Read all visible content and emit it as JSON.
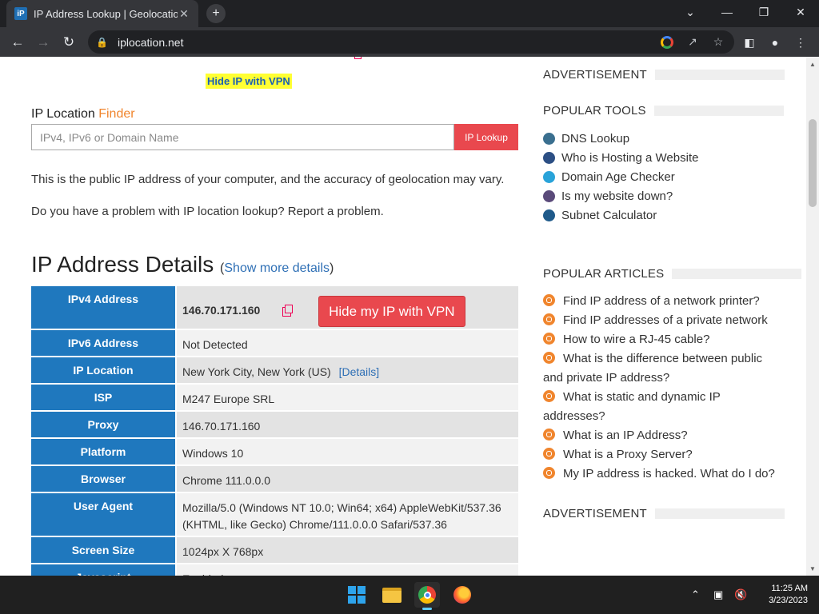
{
  "browser": {
    "tab_title": "IP Address Lookup | Geolocation",
    "tab_favicon": "iP",
    "tab_close": "✕",
    "new_tab": "+",
    "url": "iplocation.net",
    "window_controls": {
      "dropdown": "⌄",
      "minimize": "—",
      "restore": "❐",
      "close": "✕"
    }
  },
  "page": {
    "vpn_link": "Hide IP with VPN",
    "finder": {
      "title_main": "IP Location",
      "title_accent": "Finder",
      "placeholder": "IPv4, IPv6 or Domain Name",
      "button": "IP Lookup"
    },
    "para1": "This is the public IP address of your computer, and the accuracy of geolocation may vary.",
    "para2": "Do you have a problem with IP location lookup? Report a problem.",
    "details_heading": "IP Address Details",
    "details_paren_open": "(",
    "details_link": "Show more details",
    "details_paren_close": ")",
    "hide_vpn_button": "Hide my IP with VPN",
    "rows": [
      {
        "label": "IPv4 Address",
        "value": "146.70.171.160"
      },
      {
        "label": "IPv6 Address",
        "value": "Not Detected"
      },
      {
        "label": "IP Location",
        "value": "New York City, New York (US)",
        "link": "[Details]"
      },
      {
        "label": "ISP",
        "value": "M247 Europe SRL"
      },
      {
        "label": "Proxy",
        "value": "146.70.171.160"
      },
      {
        "label": "Platform",
        "value": "Windows 10"
      },
      {
        "label": "Browser",
        "value": "Chrome 111.0.0.0"
      },
      {
        "label": "User Agent",
        "value": "Mozilla/5.0 (Windows NT 10.0; Win64; x64) AppleWebKit/537.36 (KHTML, like Gecko) Chrome/111.0.0.0 Safari/537.36"
      },
      {
        "label": "Screen Size",
        "value": "1024px X 768px"
      },
      {
        "label": "Javascript",
        "value": "Enabled"
      }
    ]
  },
  "sidebar": {
    "advertisement_1": "ADVERTISEMENT",
    "popular_tools_heading": "POPULAR TOOLS",
    "tools": [
      {
        "label": "DNS Lookup",
        "icon": "globe-icon",
        "color": "#3a6f8f"
      },
      {
        "label": "Who is Hosting a Website",
        "icon": "server-icon",
        "color": "#2c4f84"
      },
      {
        "label": "Domain Age Checker",
        "icon": "cloud-icon",
        "color": "#29a3d9"
      },
      {
        "label": "Is my website down?",
        "icon": "status-icon",
        "color": "#5a4a7a"
      },
      {
        "label": "Subnet Calculator",
        "icon": "network-icon",
        "color": "#1f5a8a"
      }
    ],
    "popular_articles_heading": "POPULAR ARTICLES",
    "articles": [
      "Find IP address of a network printer?",
      "Find IP addresses of a private network",
      "How to wire a RJ-45 cable?",
      "What is the difference between public and private IP address?",
      "What is static and dynamic IP addresses?",
      "What is an IP Address?",
      "What is a Proxy Server?",
      "My IP address is hacked. What do I do?"
    ],
    "advertisement_2": "ADVERTISEMENT"
  },
  "taskbar": {
    "time": "11:25 AM",
    "date": "3/23/2023"
  },
  "colors": {
    "accent_orange": "#f0852d",
    "button_red": "#e9484e",
    "label_blue": "#1f78be",
    "link_blue": "#2e6fb5"
  }
}
